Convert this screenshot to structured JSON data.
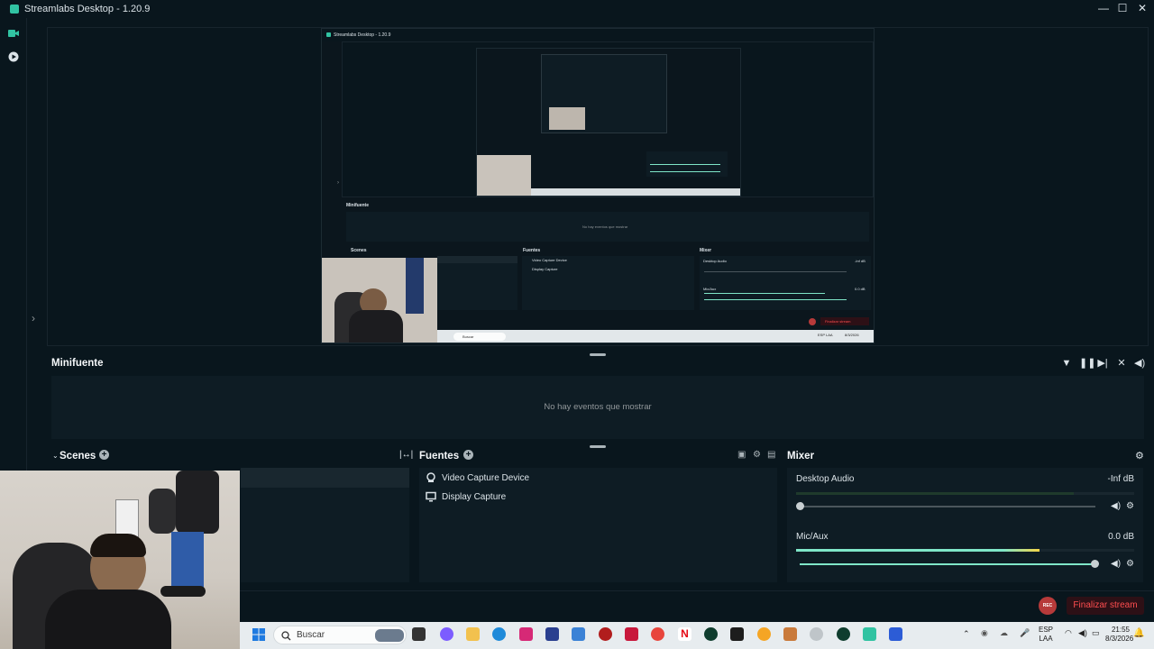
{
  "window": {
    "title": "Streamlabs Desktop - 1.20.9",
    "controls": {
      "minimize": "—",
      "maximize": "☐",
      "close": "✕"
    }
  },
  "nested_preview": {
    "title": "Streamlabs Desktop - 1.20.9",
    "minifuente": "Minifuente",
    "empty": "No hay eventos que mostrar",
    "scenes": "Scenes",
    "fuentes": "Fuentes",
    "mixer": "Mixer",
    "sources": [
      "Video Capture Device",
      "Display Capture"
    ],
    "desktop_audio": "Desktop Audio",
    "desktop_db": "-Inf dB",
    "mic": "Mic/Aux",
    "mic_db": "0.0 dB",
    "finalizar": "Finalizar stream",
    "taskbar_search": "Buscar",
    "tray_lang": "ESP LAA",
    "tray_time": "21:55",
    "tray_date": "8/3/2026"
  },
  "minifuente": {
    "title": "Minifuente",
    "empty_message": "No hay eventos que mostrar"
  },
  "scenes": {
    "title": "Scenes"
  },
  "fuentes": {
    "title": "Fuentes",
    "items": [
      {
        "label": "Video Capture Device",
        "icon": "camera-icon"
      },
      {
        "label": "Display Capture",
        "icon": "monitor-icon"
      }
    ]
  },
  "mixer": {
    "title": "Mixer",
    "channels": [
      {
        "name": "Desktop Audio",
        "db": "-Inf dB",
        "level": 0.0
      },
      {
        "name": "Mic/Aux",
        "db": "0.0 dB",
        "level": 1.0
      }
    ]
  },
  "footer": {
    "rec_label": "REC",
    "finalizar_label": "Finalizar stream"
  },
  "taskbar": {
    "search_placeholder": "Buscar",
    "lang_line1": "ESP",
    "lang_line2": "LAA",
    "time": "21:55",
    "date": "8/3/2026"
  },
  "colors": {
    "background": "#09161d",
    "panel": "#0e1c24",
    "accent": "#31c3a2",
    "danger": "#ff4d4f"
  }
}
